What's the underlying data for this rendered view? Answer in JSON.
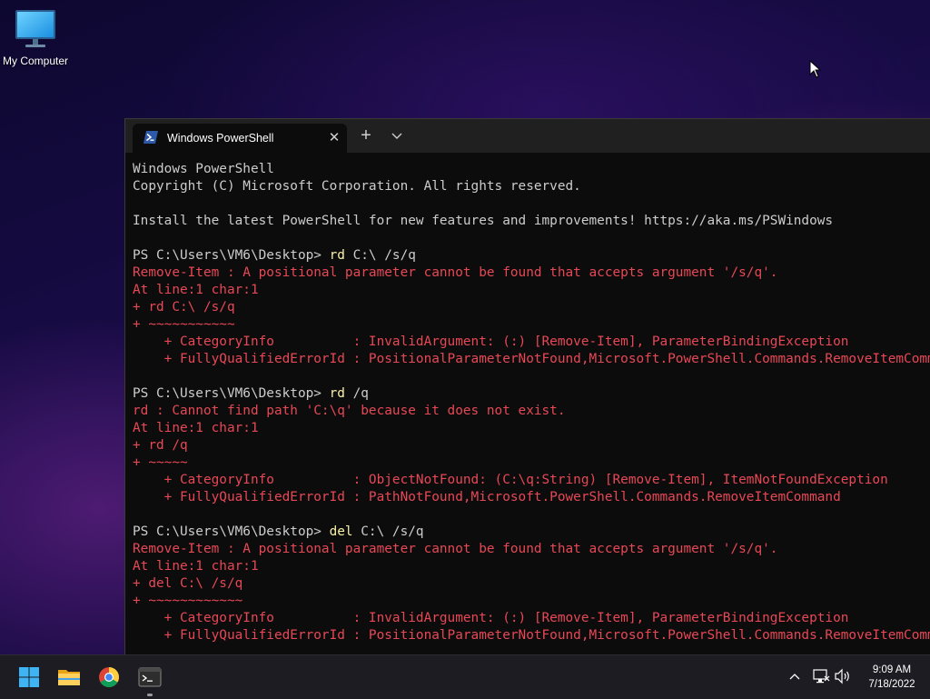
{
  "desktop": {
    "icons": [
      {
        "label": "My Computer",
        "icon": "monitor-icon"
      }
    ]
  },
  "terminal": {
    "tab_title": "Windows PowerShell",
    "tab_icon": "powershell-icon",
    "new_tab_glyph": "+",
    "close_glyph": "✕",
    "colors": {
      "background": "#0c0c0c",
      "text": "#cccccc",
      "error": "#e74856",
      "command": "#f9f1a5"
    },
    "lines": [
      {
        "type": "out",
        "text": "Windows PowerShell"
      },
      {
        "type": "out",
        "text": "Copyright (C) Microsoft Corporation. All rights reserved."
      },
      {
        "type": "out",
        "text": ""
      },
      {
        "type": "out",
        "text": "Install the latest PowerShell for new features and improvements! https://aka.ms/PSWindows"
      },
      {
        "type": "out",
        "text": ""
      },
      {
        "type": "prompt",
        "prompt": "PS C:\\Users\\VM6\\Desktop> ",
        "cmd": "rd",
        "args": " C:\\ /s/q"
      },
      {
        "type": "err",
        "text": "Remove-Item : A positional parameter cannot be found that accepts argument '/s/q'."
      },
      {
        "type": "err",
        "text": "At line:1 char:1"
      },
      {
        "type": "err",
        "text": "+ rd C:\\ /s/q"
      },
      {
        "type": "err",
        "text": "+ ~~~~~~~~~~~"
      },
      {
        "type": "err",
        "text": "    + CategoryInfo          : InvalidArgument: (:) [Remove-Item], ParameterBindingException"
      },
      {
        "type": "err",
        "text": "    + FullyQualifiedErrorId : PositionalParameterNotFound,Microsoft.PowerShell.Commands.RemoveItemCommand"
      },
      {
        "type": "out",
        "text": ""
      },
      {
        "type": "prompt",
        "prompt": "PS C:\\Users\\VM6\\Desktop> ",
        "cmd": "rd",
        "args": " /q"
      },
      {
        "type": "err",
        "text": "rd : Cannot find path 'C:\\q' because it does not exist."
      },
      {
        "type": "err",
        "text": "At line:1 char:1"
      },
      {
        "type": "err",
        "text": "+ rd /q"
      },
      {
        "type": "err",
        "text": "+ ~~~~~"
      },
      {
        "type": "err",
        "text": "    + CategoryInfo          : ObjectNotFound: (C:\\q:String) [Remove-Item], ItemNotFoundException"
      },
      {
        "type": "err",
        "text": "    + FullyQualifiedErrorId : PathNotFound,Microsoft.PowerShell.Commands.RemoveItemCommand"
      },
      {
        "type": "out",
        "text": ""
      },
      {
        "type": "prompt",
        "prompt": "PS C:\\Users\\VM6\\Desktop> ",
        "cmd": "del",
        "args": " C:\\ /s/q"
      },
      {
        "type": "err",
        "text": "Remove-Item : A positional parameter cannot be found that accepts argument '/s/q'."
      },
      {
        "type": "err",
        "text": "At line:1 char:1"
      },
      {
        "type": "err",
        "text": "+ del C:\\ /s/q"
      },
      {
        "type": "err",
        "text": "+ ~~~~~~~~~~~~"
      },
      {
        "type": "err",
        "text": "    + CategoryInfo          : InvalidArgument: (:) [Remove-Item], ParameterBindingException"
      },
      {
        "type": "err",
        "text": "    + FullyQualifiedErrorId : PositionalParameterNotFound,Microsoft.PowerShell.Commands.RemoveItemCommand"
      }
    ]
  },
  "taskbar": {
    "apps": [
      {
        "name": "start",
        "icon": "windows-start-icon"
      },
      {
        "name": "file-explorer",
        "icon": "folder-icon"
      },
      {
        "name": "chrome",
        "icon": "chrome-icon"
      },
      {
        "name": "terminal",
        "icon": "terminal-icon",
        "active": true
      }
    ],
    "tray": {
      "icons": [
        "chevron-up-icon",
        "network-icon",
        "volume-icon"
      ]
    },
    "clock": {
      "time": "9:09 AM",
      "date": "7/18/2022"
    }
  }
}
